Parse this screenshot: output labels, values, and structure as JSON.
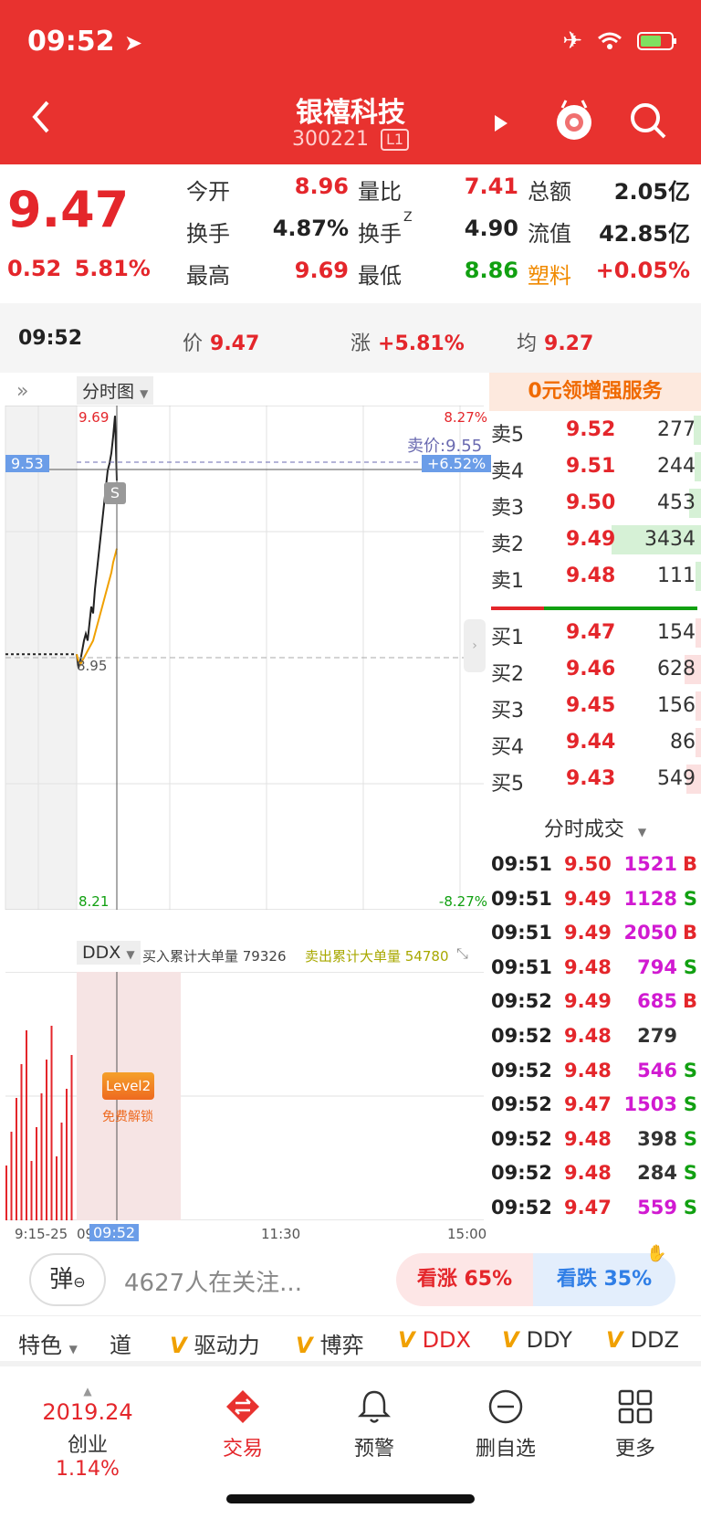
{
  "status": {
    "time": "09:52"
  },
  "header": {
    "title": "银禧科技",
    "code": "300221",
    "level_badge": "L1"
  },
  "quote": {
    "price": "9.47",
    "change": "0.52",
    "change_pct": "5.81%",
    "fields": [
      {
        "label": "今开",
        "value": "8.96",
        "color": "#e4262b"
      },
      {
        "label": "量比",
        "value": "7.41",
        "color": "#e4262b"
      },
      {
        "label": "总额",
        "value": "2.05亿",
        "color": "#222222"
      },
      {
        "label": "换手",
        "value": "4.87%",
        "color": "#222222"
      },
      {
        "label": "换手",
        "sup": "Z",
        "value": "4.90",
        "color": "#222222"
      },
      {
        "label": "流值",
        "value": "42.85亿",
        "color": "#222222"
      },
      {
        "label": "最高",
        "value": "9.69",
        "color": "#e4262b"
      },
      {
        "label": "最低",
        "value": "8.86",
        "color": "#11a011"
      },
      {
        "label": "塑料",
        "value": "+0.05%",
        "color": "#e4262b"
      }
    ]
  },
  "info_bar": {
    "time": "09:52",
    "price_label": "价",
    "price": "9.47",
    "chg_label": "涨",
    "chg": "+5.81%",
    "avg_label": "均",
    "avg": "9.27"
  },
  "chart": {
    "tab": "分时图",
    "high_price": "9.69",
    "low_price": "8.21",
    "high_pct": "8.27%",
    "low_pct": "-8.27%",
    "cursor_price": "9.53",
    "cursor_pct": "+6.52%",
    "ask_label": "卖价:9.55",
    "prev_close": "8.95",
    "s_marker": "S",
    "ddx_tab": "DDX",
    "buy_big": "买入累计大单量 79326",
    "sell_big": "卖出累计大单量 54780",
    "level2_badge": "Level2",
    "level2_unlock": "免费解锁",
    "time_axis": [
      "9:15-25",
      "09",
      "09:52",
      "11:30",
      "15:00"
    ]
  },
  "chart_data": {
    "type": "line",
    "title": "",
    "xlabel": "",
    "ylabel": "",
    "ylim": [
      8.21,
      9.69
    ],
    "prev_close": 8.95,
    "series": [
      {
        "name": "",
        "color": "#222222",
        "x": [
          "09:30",
          "09:31",
          "09:32",
          "09:33",
          "09:34",
          "09:35",
          "09:36",
          "09:37",
          "09:38",
          "09:39",
          "09:40",
          "09:41",
          "09:42",
          "09:43",
          "09:44",
          "09:45",
          "09:46",
          "09:47",
          "09:48",
          "09:49",
          "09:50",
          "09:51",
          "09:52"
        ],
        "values": [
          8.96,
          8.92,
          8.94,
          8.97,
          9.0,
          9.02,
          9.0,
          9.05,
          9.1,
          9.08,
          9.15,
          9.2,
          9.25,
          9.3,
          9.35,
          9.4,
          9.45,
          9.5,
          9.52,
          9.55,
          9.6,
          9.66,
          9.47
        ]
      },
      {
        "name": "",
        "color": "#f0a000",
        "x": [
          "09:30",
          "09:31",
          "09:32",
          "09:33",
          "09:34",
          "09:35",
          "09:36",
          "09:37",
          "09:38",
          "09:39",
          "09:40",
          "09:41",
          "09:42",
          "09:43",
          "09:44",
          "09:45",
          "09:46",
          "09:47",
          "09:48",
          "09:49",
          "09:50",
          "09:51",
          "09:52"
        ],
        "values": [
          8.96,
          8.94,
          8.93,
          8.94,
          8.95,
          8.96,
          8.97,
          8.98,
          8.99,
          9.0,
          9.02,
          9.04,
          9.06,
          9.08,
          9.1,
          9.12,
          9.14,
          9.16,
          9.18,
          9.2,
          9.23,
          9.25,
          9.27
        ]
      }
    ]
  },
  "promo": "0元领增强服务",
  "order_book": {
    "asks": [
      {
        "label": "卖5",
        "price": "9.52",
        "vol": "277",
        "frac": 0.08
      },
      {
        "label": "卖4",
        "price": "9.51",
        "vol": "244",
        "frac": 0.07
      },
      {
        "label": "卖3",
        "price": "9.50",
        "vol": "453",
        "frac": 0.13
      },
      {
        "label": "卖2",
        "price": "9.49",
        "vol": "3434",
        "frac": 1.0
      },
      {
        "label": "卖1",
        "price": "9.48",
        "vol": "111",
        "frac": 0.03
      }
    ],
    "bids": [
      {
        "label": "买1",
        "price": "9.47",
        "vol": "154",
        "frac": 0.05
      },
      {
        "label": "买2",
        "price": "9.46",
        "vol": "628",
        "frac": 0.18
      },
      {
        "label": "买3",
        "price": "9.45",
        "vol": "156",
        "frac": 0.05
      },
      {
        "label": "买4",
        "price": "9.44",
        "vol": "86",
        "frac": 0.03
      },
      {
        "label": "买5",
        "price": "9.43",
        "vol": "549",
        "frac": 0.16
      }
    ]
  },
  "ticks_title": "分时成交",
  "ticks": [
    {
      "time": "09:51",
      "price": "9.50",
      "vol": "1521",
      "dir": "B",
      "vcolor": "#d11ad1"
    },
    {
      "time": "09:51",
      "price": "9.49",
      "vol": "1128",
      "dir": "S",
      "vcolor": "#d11ad1"
    },
    {
      "time": "09:51",
      "price": "9.49",
      "vol": "2050",
      "dir": "B",
      "vcolor": "#d11ad1"
    },
    {
      "time": "09:51",
      "price": "9.48",
      "vol": "794",
      "dir": "S",
      "vcolor": "#d11ad1"
    },
    {
      "time": "09:52",
      "price": "9.49",
      "vol": "685",
      "dir": "B",
      "vcolor": "#d11ad1"
    },
    {
      "time": "09:52",
      "price": "9.48",
      "vol": "279",
      "dir": "",
      "vcolor": "#333333"
    },
    {
      "time": "09:52",
      "price": "9.48",
      "vol": "546",
      "dir": "S",
      "vcolor": "#d11ad1"
    },
    {
      "time": "09:52",
      "price": "9.47",
      "vol": "1503",
      "dir": "S",
      "vcolor": "#d11ad1"
    },
    {
      "time": "09:52",
      "price": "9.48",
      "vol": "398",
      "dir": "S",
      "vcolor": "#333333"
    },
    {
      "time": "09:52",
      "price": "9.48",
      "vol": "284",
      "dir": "S",
      "vcolor": "#333333"
    },
    {
      "time": "09:52",
      "price": "9.47",
      "vol": "559",
      "dir": "S",
      "vcolor": "#d11ad1"
    }
  ],
  "social": {
    "dan_label": "弹",
    "watchers": "4627人在关注...",
    "bull": "看涨 65%",
    "bear": "看跌 35%"
  },
  "indicators": {
    "special": "特色",
    "items": [
      "道",
      "驱动力",
      "博弈",
      "DDX",
      "DDY",
      "DDZ"
    ],
    "v_mark": "V"
  },
  "nav": {
    "index_value": "2019.24",
    "index_name": "创业",
    "index_pct": "1.14%",
    "items": [
      {
        "label": "交易"
      },
      {
        "label": "预警"
      },
      {
        "label": "删自选"
      },
      {
        "label": "更多"
      }
    ]
  }
}
